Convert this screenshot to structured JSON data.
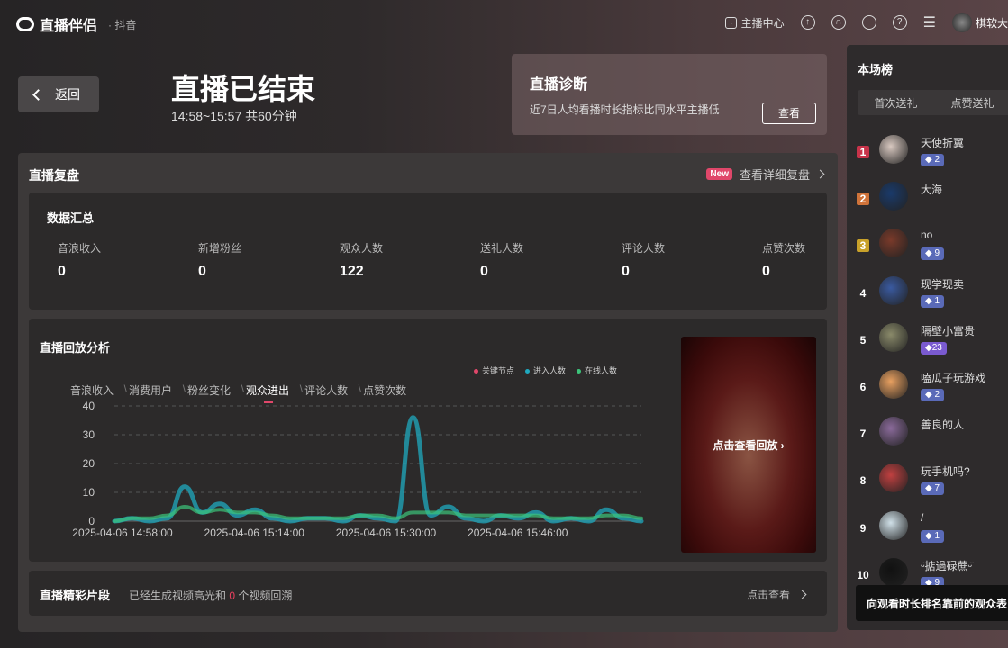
{
  "header": {
    "app_name": "直播伴侣",
    "platform": "· 抖音",
    "anchor_center": "主播中心",
    "user_name": "棋软大",
    "icons": [
      "chart-icon",
      "upload-icon",
      "headset-icon",
      "chat-icon",
      "help-icon",
      "menu-icon"
    ]
  },
  "back": {
    "label": "返回"
  },
  "end": {
    "title": "直播已结束",
    "time": "14:58~15:57 共60分钟"
  },
  "diagnosis": {
    "title": "直播诊断",
    "text": "近7日人均看播时长指标比同水平主播低",
    "button": "查看"
  },
  "review": {
    "title": "直播复盘",
    "new_badge": "New",
    "detail_link": "查看详细复盘",
    "summary": {
      "title": "数据汇总",
      "stats": [
        {
          "label": "音浪收入",
          "value": "0"
        },
        {
          "label": "新增粉丝",
          "value": "0"
        },
        {
          "label": "观众人数",
          "value": "122"
        },
        {
          "label": "送礼人数",
          "value": "0"
        },
        {
          "label": "评论人数",
          "value": "0"
        },
        {
          "label": "点赞次数",
          "value": "0"
        }
      ]
    },
    "analysis": {
      "title": "直播回放分析",
      "tabs": [
        "音浪收入",
        "消费用户",
        "粉丝变化",
        "观众进出",
        "评论人数",
        "点赞次数"
      ],
      "active_tab": "观众进出",
      "replay_label": "点击查看回放"
    },
    "clips": {
      "title": "直播精彩片段",
      "text_prefix": "已经生成视频高光和",
      "count": "0",
      "text_suffix": "个视频回溯",
      "link": "点击查看"
    }
  },
  "chart_data": {
    "type": "line",
    "x": [
      "14:58",
      "15:00",
      "15:02",
      "15:04",
      "15:06",
      "15:08",
      "15:10",
      "15:12",
      "15:14",
      "15:16",
      "15:18",
      "15:20",
      "15:22",
      "15:24",
      "15:26",
      "15:28",
      "15:30",
      "15:32",
      "15:34",
      "15:36",
      "15:38",
      "15:40",
      "15:42",
      "15:44",
      "15:46",
      "15:48",
      "15:50",
      "15:52",
      "15:54",
      "15:56",
      "15:57"
    ],
    "x_tick_labels": [
      "2025-04-06 14:58:00",
      "2025-04-06 15:14:00",
      "2025-04-06 15:30:00",
      "2025-04-06 15:46:00"
    ],
    "ylim": [
      0,
      40
    ],
    "y_ticks": [
      0,
      10,
      20,
      30,
      40
    ],
    "grid": true,
    "legend_position": "top-right",
    "series": [
      {
        "name": "关键节点",
        "color": "#e0476a",
        "values": []
      },
      {
        "name": "进入人数",
        "color": "#1fa9bf",
        "values": [
          0,
          1,
          0,
          1,
          12,
          3,
          6,
          2,
          4,
          1,
          0,
          1,
          1,
          0,
          2,
          1,
          0,
          36,
          2,
          5,
          1,
          0,
          2,
          1,
          3,
          0,
          1,
          0,
          4,
          1,
          0
        ]
      },
      {
        "name": "在线人数",
        "color": "#3cc47a",
        "values": [
          0,
          1,
          1,
          2,
          5,
          3,
          4,
          3,
          3,
          2,
          1,
          1,
          1,
          1,
          2,
          2,
          1,
          3,
          3,
          3,
          2,
          2,
          2,
          2,
          2,
          1,
          1,
          1,
          2,
          2,
          1
        ]
      }
    ]
  },
  "ranking": {
    "title": "本场榜",
    "tabs": [
      "首次送礼",
      "点赞送礼"
    ],
    "items": [
      {
        "rank": "1",
        "name": "天使折翼",
        "badge": "◆ 2"
      },
      {
        "rank": "2",
        "name": "大海",
        "badge": ""
      },
      {
        "rank": "3",
        "name": "no",
        "badge": "◆ 9"
      },
      {
        "rank": "4",
        "name": "现学现卖",
        "badge": "◆ 1"
      },
      {
        "rank": "5",
        "name": "隔壁小富贵",
        "badge": "◆23"
      },
      {
        "rank": "6",
        "name": "嗑瓜子玩游戏",
        "badge": "◆ 2"
      },
      {
        "rank": "7",
        "name": "善良的人",
        "badge": ""
      },
      {
        "rank": "8",
        "name": "玩手机吗?",
        "badge": "◆ 7"
      },
      {
        "rank": "9",
        "name": "/",
        "badge": "◆ 1"
      },
      {
        "rank": "10",
        "name": "ᵕ̈掂過碌蔗ᵕ̈",
        "badge": "◆ 9"
      }
    ],
    "tooltip": "向观看时长排名靠前的观众表"
  }
}
